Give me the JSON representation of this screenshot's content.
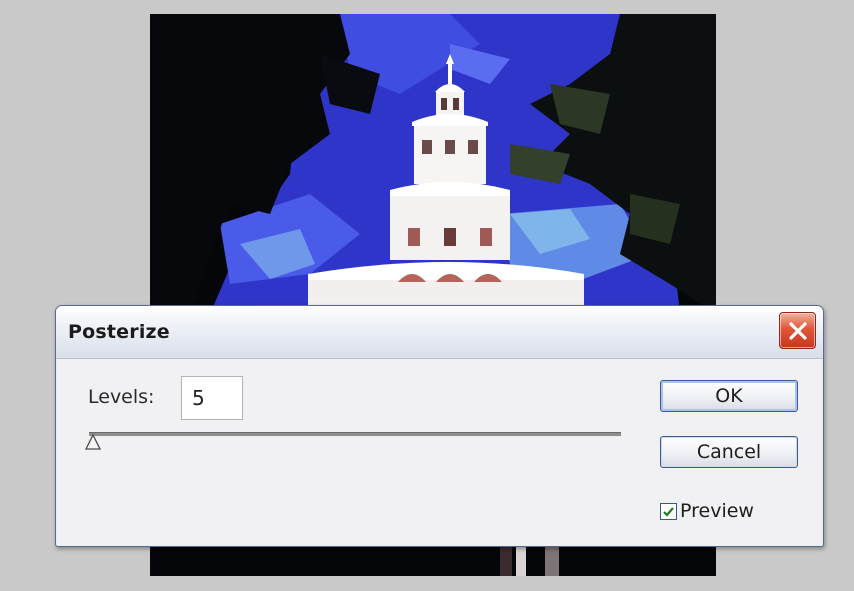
{
  "dialog": {
    "title": "Posterize",
    "close_icon": "close-x-icon",
    "levels": {
      "label": "Levels:",
      "value": "5"
    },
    "slider": {
      "value": 5,
      "thumb_icon": "triangle-slider-thumb-icon"
    },
    "buttons": {
      "ok_label": "OK",
      "cancel_label": "Cancel"
    },
    "preview": {
      "label": "Preview",
      "checked": true
    }
  },
  "colors": {
    "sky": "#2e35c8",
    "close_button": "#d94a2e",
    "button_border": "#3f5a93",
    "dialog_bg": "#f1f1f3"
  }
}
